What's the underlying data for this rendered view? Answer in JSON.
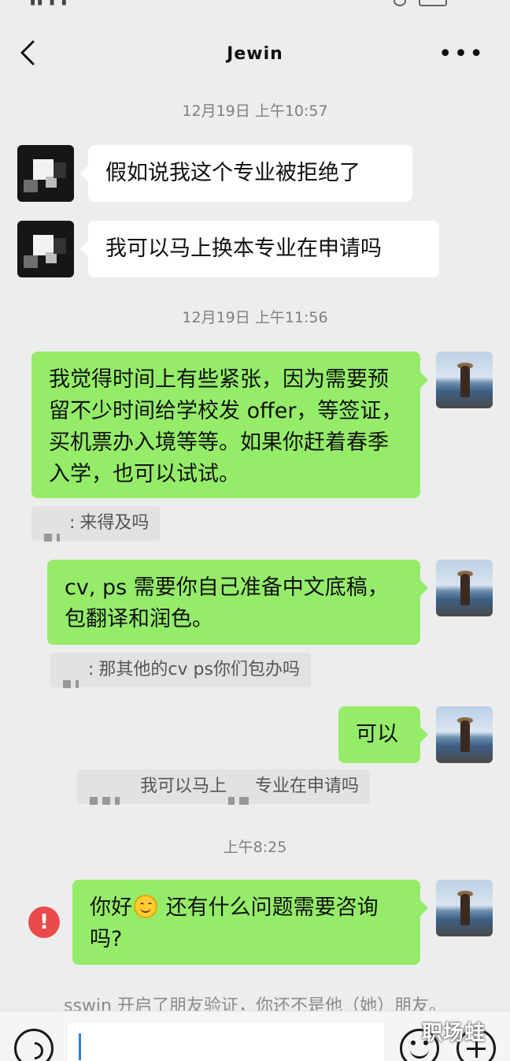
{
  "header": {
    "title": "Jewin"
  },
  "messages": [
    {
      "type": "time",
      "text": "12月19日 上午10:57"
    },
    {
      "type": "in",
      "text": "假如说我这个专业被拒绝了"
    },
    {
      "type": "in",
      "text": "我可以马上换本专业在申请吗"
    },
    {
      "type": "time",
      "text": "12月19日 上午11:56"
    },
    {
      "type": "out",
      "text": "我觉得时间上有些紧张，因为需要预留不少时间给学校发 offer，等签证，买机票办入境等等。如果你赶着春季入学，也可以试试。"
    },
    {
      "type": "quote",
      "text": "来得及吗"
    },
    {
      "type": "out",
      "text": "cv, ps 需要你自己准备中文底稿，包翻译和润色。"
    },
    {
      "type": "quote",
      "text": "那其他的cv ps你们包办吗"
    },
    {
      "type": "out",
      "text": "可以"
    },
    {
      "type": "quote",
      "text_before": "我可以马上",
      "text_after": "专业在申请吗"
    },
    {
      "type": "time",
      "text": "上午8:25"
    },
    {
      "type": "out_failed",
      "text_before": "你好",
      "emoji": "smile-emoji",
      "text_after": " 还有什么问题需要咨询吗?"
    }
  ],
  "quote_separator": ":",
  "system_note": "sswin 开启了朋友验证，你还不是他（她）朋友。",
  "watermark": "职场蛙",
  "colors": {
    "outgoing_bubble": "#95ec69",
    "incoming_bubble": "#ffffff",
    "background": "#ededed",
    "error": "#e94b4b"
  }
}
